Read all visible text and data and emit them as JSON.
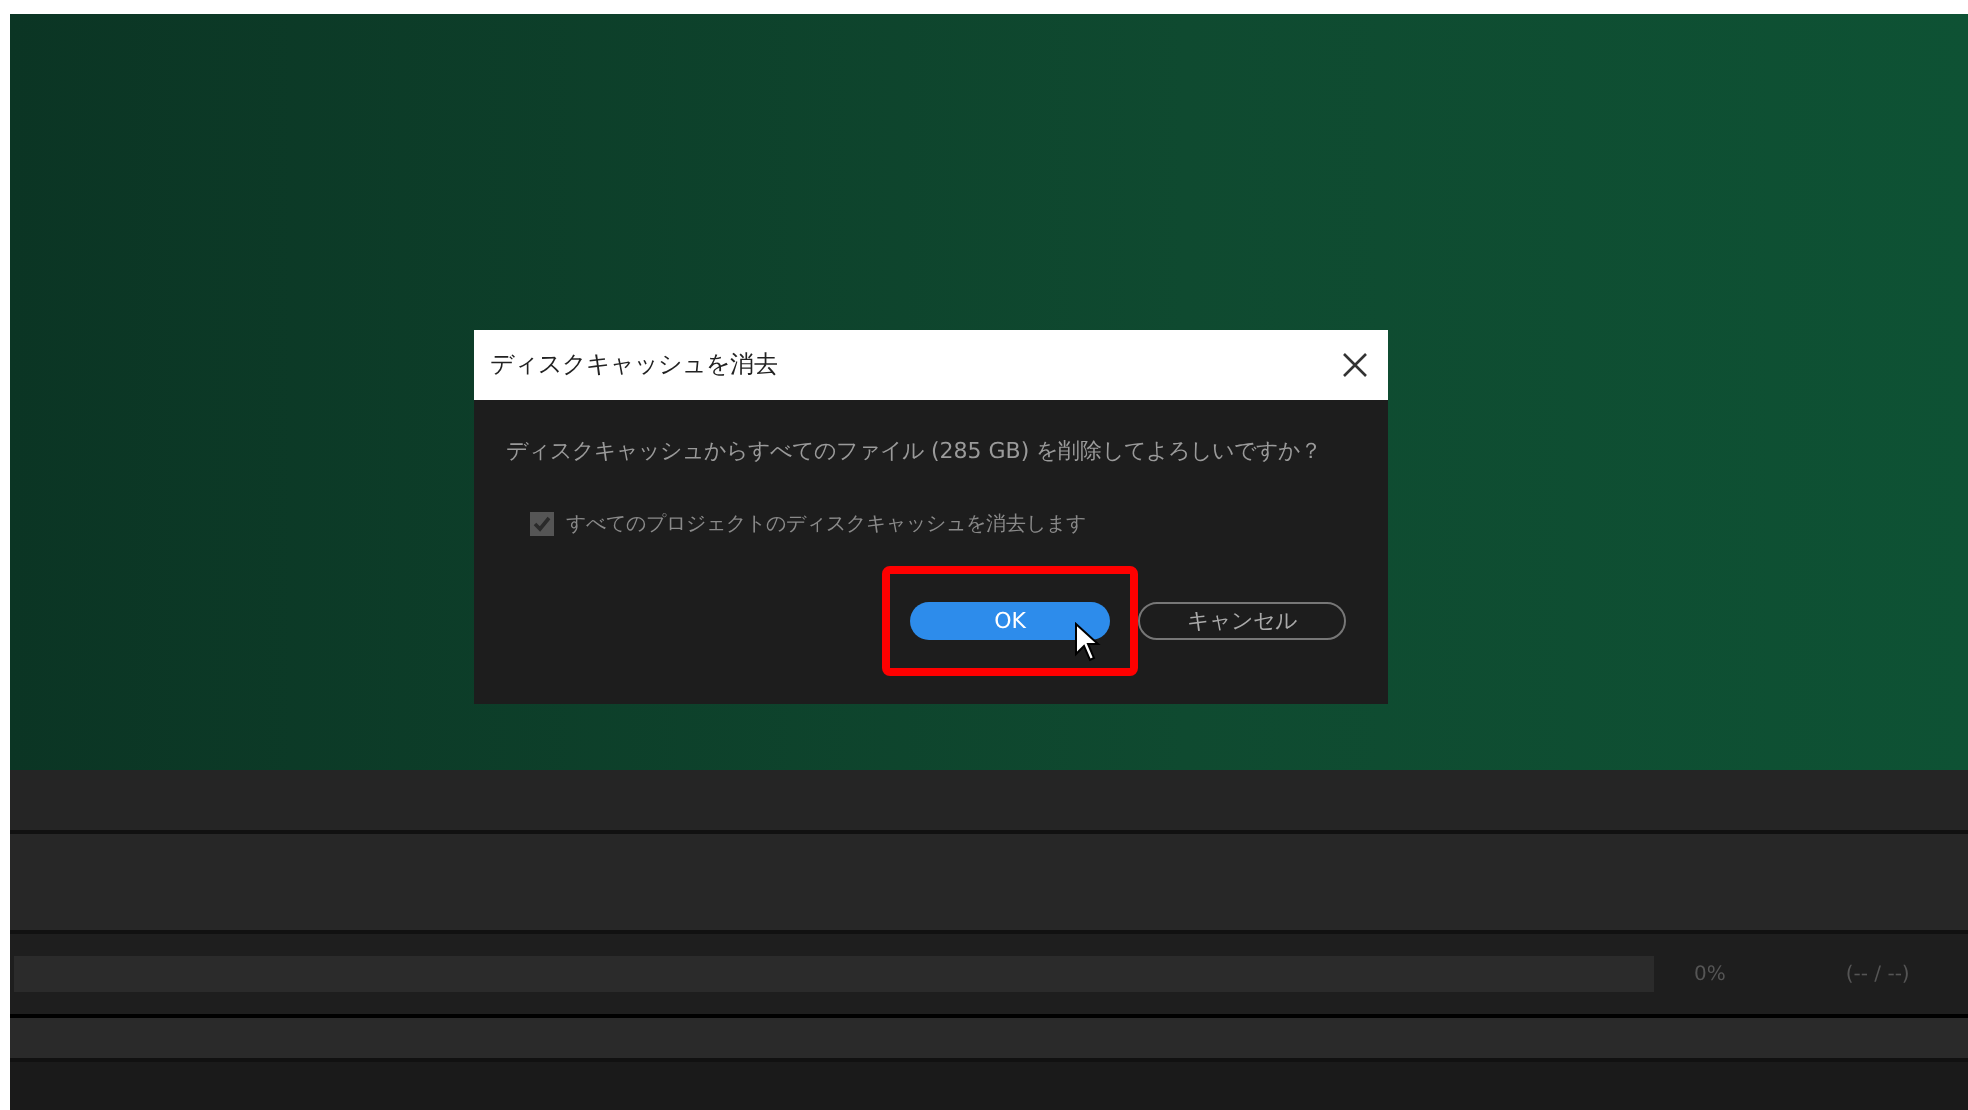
{
  "dialog": {
    "title": "ディスクキャッシュを消去",
    "message": "ディスクキャッシュからすべてのファイル (285 GB) を削除してよろしいですか？",
    "checkbox": {
      "label": "すべてのプロジェクトのディスクキャッシュを消去します",
      "checked": true,
      "disabled": true
    },
    "buttons": [
      {
        "label": "OK",
        "kind": "primary",
        "highlighted": true
      },
      {
        "label": "キャンセル",
        "kind": "secondary",
        "highlighted": false
      }
    ]
  },
  "status_bar": {
    "level": 0,
    "percent": "0%",
    "count": "(-- / --)"
  }
}
